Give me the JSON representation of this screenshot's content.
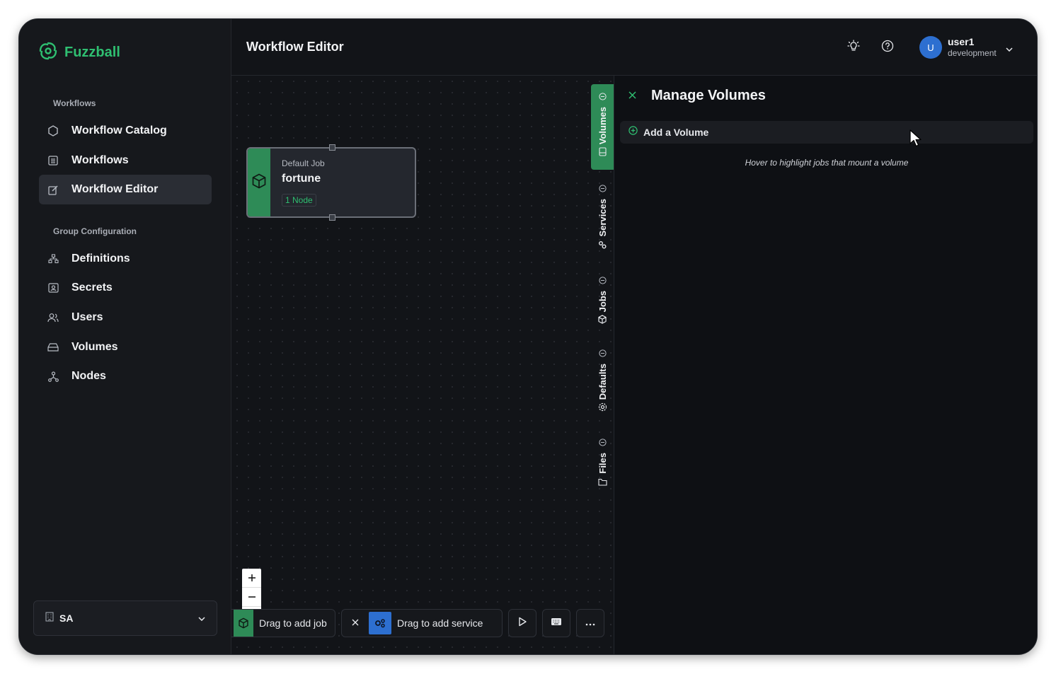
{
  "brand": {
    "name": "Fuzzball"
  },
  "sidebar": {
    "sections": [
      {
        "label": "Workflows",
        "items": [
          {
            "label": "Workflow Catalog",
            "icon": "hexagon-icon"
          },
          {
            "label": "Workflows",
            "icon": "list-icon"
          },
          {
            "label": "Workflow Editor",
            "icon": "edit-icon",
            "active": true
          }
        ]
      },
      {
        "label": "Group Configuration",
        "items": [
          {
            "label": "Definitions",
            "icon": "sitemap-icon"
          },
          {
            "label": "Secrets",
            "icon": "secret-icon"
          },
          {
            "label": "Users",
            "icon": "users-icon"
          },
          {
            "label": "Volumes",
            "icon": "drive-icon"
          },
          {
            "label": "Nodes",
            "icon": "nodes-icon"
          }
        ]
      }
    ],
    "org": {
      "name": "SA"
    }
  },
  "header": {
    "title": "Workflow Editor",
    "user": {
      "initial": "U",
      "name": "user1",
      "env": "development"
    }
  },
  "canvas": {
    "job": {
      "kind": "Default Job",
      "name": "fortune",
      "badge": "1 Node"
    },
    "toolbar": {
      "add_job": "Drag to add job",
      "add_service": "Drag to add service"
    }
  },
  "vtabs": [
    {
      "label": "Volumes",
      "active": true
    },
    {
      "label": "Services",
      "active": false
    },
    {
      "label": "Jobs",
      "active": false
    },
    {
      "label": "Defaults",
      "active": false
    },
    {
      "label": "Files",
      "active": false
    }
  ],
  "panel": {
    "title": "Manage Volumes",
    "add_label": "Add a Volume",
    "hint": "Hover to highlight jobs that mount a volume"
  },
  "colors": {
    "accent": "#2fbf71",
    "active_tab": "#2e8b57",
    "avatar": "#2d6fd0"
  }
}
